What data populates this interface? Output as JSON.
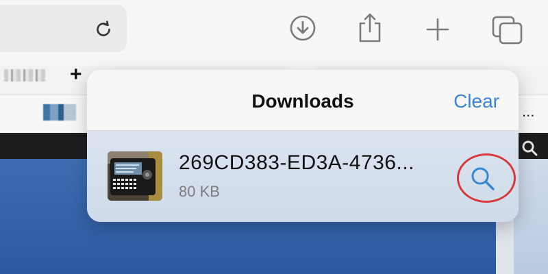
{
  "toolbar": {
    "icons": [
      "reload-icon",
      "downloads-icon",
      "share-icon",
      "new-tab-icon",
      "tabs-overview-icon"
    ]
  },
  "tabbar": {
    "plus_label": "+"
  },
  "bookmarks": {
    "overflow_label": "..."
  },
  "downloads": {
    "title": "Downloads",
    "clear_label": "Clear",
    "items": [
      {
        "name": "269CD383-ED3A-4736...",
        "size": "80 KB"
      }
    ]
  },
  "colors": {
    "accent": "#3a86d6",
    "annotation": "#d8383a",
    "page_blue": "#2c5aa0"
  }
}
